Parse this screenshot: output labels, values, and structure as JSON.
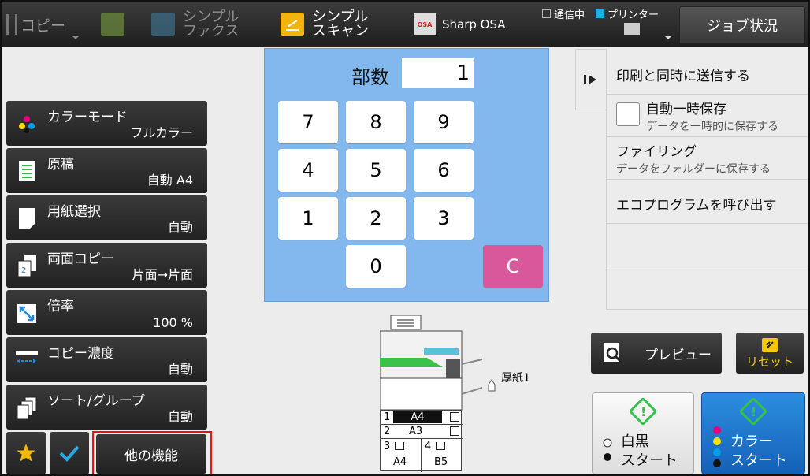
{
  "topbar": {
    "copy_label": "コピー",
    "fax_label_1": "シンプル",
    "fax_label_2": "ファクス",
    "scan_label_1": "シンプル",
    "scan_label_2": "スキャン",
    "osa_label": "Sharp OSA",
    "osa_icon_text": "OSA",
    "status_sending": "通信中",
    "status_printer": "プリンター",
    "job_status": "ジョブ状況"
  },
  "left_menu": [
    {
      "title": "カラーモード",
      "value": "フルカラー",
      "icon": "color-mode-icon"
    },
    {
      "title": "原稿",
      "value": "自動 A4",
      "icon": "original-icon"
    },
    {
      "title": "用紙選択",
      "value": "自動",
      "icon": "paper-select-icon"
    },
    {
      "title": "両面コピー",
      "value": "片面→片面",
      "icon": "duplex-icon"
    },
    {
      "title": "倍率",
      "value": "100 %",
      "icon": "zoom-icon"
    },
    {
      "title": "コピー濃度",
      "value": "自動",
      "icon": "density-icon"
    },
    {
      "title": "ソート/グループ",
      "value": "自動",
      "icon": "sort-icon"
    }
  ],
  "bottom": {
    "other_functions": "他の機能"
  },
  "keypad": {
    "copies_label": "部数",
    "copies_value": "1",
    "keys": [
      "7",
      "8",
      "9",
      "4",
      "5",
      "6",
      "1",
      "2",
      "3",
      "0"
    ],
    "clear": "C"
  },
  "right_panel": {
    "send_while_print": "印刷と同時に送信する",
    "auto_temp_save": "自動一時保存",
    "auto_temp_save_sub": "データを一時的に保存する",
    "filing": "ファイリング",
    "filing_sub": "データをフォルダーに保存する",
    "eco_program": "エコプログラムを呼び出す"
  },
  "printer": {
    "trays": [
      {
        "num": "1",
        "size": "A4"
      },
      {
        "num": "2",
        "size": "A3"
      },
      {
        "num": "3",
        "size": "A4"
      },
      {
        "num": "4",
        "size": "B5"
      }
    ],
    "bypass_label": "厚紙1"
  },
  "actions": {
    "preview": "プレビュー",
    "reset": "リセット",
    "bw_start_1": "白黒",
    "bw_start_2": "スタート",
    "color_start_1": "カラー",
    "color_start_2": "スタート"
  },
  "colors": {
    "keypad_bg": "#82b8ee",
    "clear_key": "#d9579b",
    "color_start": "#1f78d0",
    "highlight_border": "#e11111",
    "reset_text": "#f5c800"
  }
}
